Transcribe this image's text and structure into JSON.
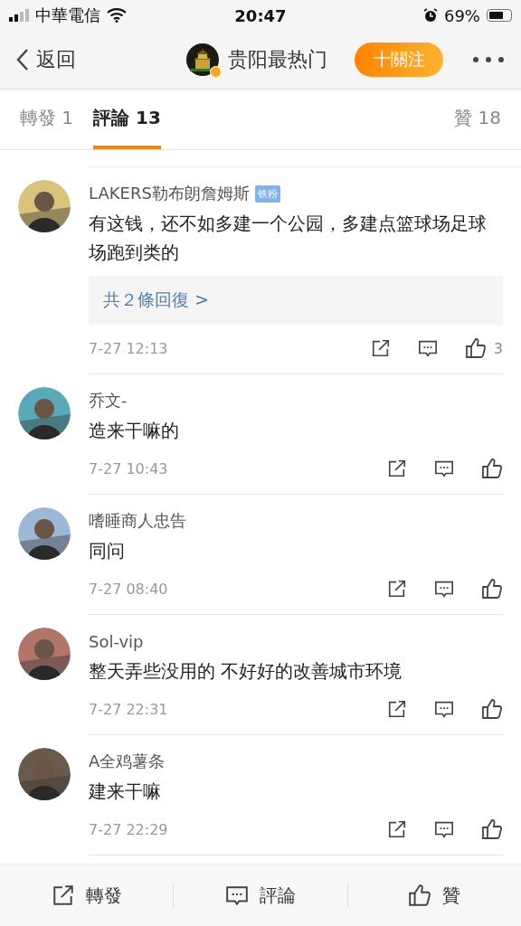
{
  "status_bar": {
    "carrier": "中華電信",
    "time": "20:47",
    "battery": "69%"
  },
  "nav": {
    "back": "返回",
    "account": "贵阳最热门",
    "verified": true,
    "follow": "十關注"
  },
  "tabs": [
    {
      "label": "轉發 1",
      "selected": false
    },
    {
      "label": "評論 13",
      "selected": true
    },
    {
      "label": "贊 18",
      "selected": false
    }
  ],
  "comments": [
    {
      "name": "LAKERS勒布朗詹姆斯",
      "badge": "铁粉",
      "text": "有这钱，还不如多建一个公园，多建点篮球场足球场跑到类的",
      "replies": "共２條回復 >",
      "time": "7-27 12:13",
      "likes": "3"
    },
    {
      "name": "乔文-",
      "text": "造来干嘛的",
      "time": "7-27 10:43"
    },
    {
      "name": "嗜睡商人忠告",
      "text": "同问",
      "time": "7-27 08:40"
    },
    {
      "name": "Sol-vip",
      "text": "整天弄些没用的 不好好的改善城市环境",
      "time": "7-27 22:31"
    },
    {
      "name": "A全鸡薯条",
      "text": "建来干嘛",
      "time": "7-27 22:29"
    }
  ],
  "bottom_bar": [
    {
      "label": "轉發",
      "kind": "repost"
    },
    {
      "label": "評論",
      "kind": "comment"
    },
    {
      "label": "贊",
      "kind": "like"
    }
  ]
}
